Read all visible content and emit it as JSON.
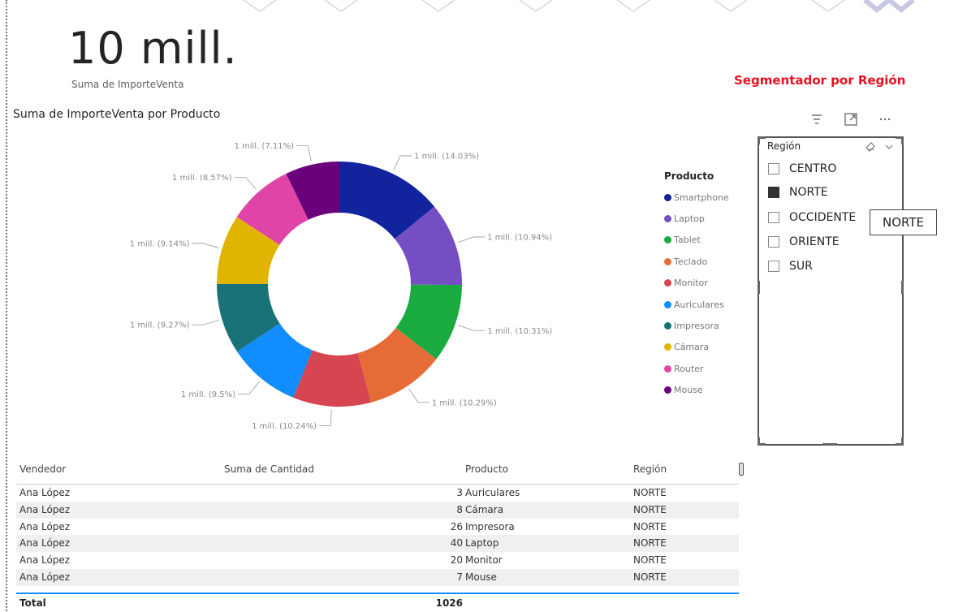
{
  "kpi": {
    "value": "10 mill.",
    "label": "Suma de ImporteVenta"
  },
  "chart_data": {
    "type": "pie",
    "donut": true,
    "title": "Suma de ImporteVenta por Producto",
    "legend_title": "Producto",
    "legend_position": "right",
    "slices": [
      {
        "name": "Smartphone",
        "label": "1 mill. (14.03%)",
        "value": 14.03,
        "color": "#12239e"
      },
      {
        "name": "Laptop",
        "label": "1 mill. (10.94%)",
        "value": 10.94,
        "color": "#744ec2"
      },
      {
        "name": "Tablet",
        "label": "1 mill. (10.31%)",
        "value": 10.31,
        "color": "#1aab40"
      },
      {
        "name": "Teclado",
        "label": "1 mill. (10.29%)",
        "value": 10.29,
        "color": "#e66c37"
      },
      {
        "name": "Monitor",
        "label": "1 mill. (10.24%)",
        "value": 10.24,
        "color": "#d64550"
      },
      {
        "name": "Auriculares",
        "label": "1 mill. (9.5%)",
        "value": 9.5,
        "color": "#118dff"
      },
      {
        "name": "Impresora",
        "label": "1 mill. (9.27%)",
        "value": 9.27,
        "color": "#197278"
      },
      {
        "name": "Cámara",
        "label": "1 mill. (9.14%)",
        "value": 9.14,
        "color": "#e0b400"
      },
      {
        "name": "Router",
        "label": "1 mill. (8.57%)",
        "value": 8.57,
        "color": "#e044a7"
      },
      {
        "name": "Mouse",
        "label": "1 mill. (7.11%)",
        "value": 7.11,
        "color": "#6b007b"
      }
    ]
  },
  "slicer": {
    "heading": "Segmentador por Región",
    "title": "Región",
    "toolbar_icons": [
      "filter-icon",
      "focus-mode-icon",
      "more-options-icon"
    ],
    "items": [
      {
        "label": "CENTRO",
        "checked": false
      },
      {
        "label": "NORTE",
        "checked": true
      },
      {
        "label": "OCCIDENTE",
        "checked": false
      },
      {
        "label": "ORIENTE",
        "checked": false
      },
      {
        "label": "SUR",
        "checked": false
      }
    ],
    "tooltip": "NORTE"
  },
  "table": {
    "headers": [
      "Vendedor",
      "Suma de Cantidad",
      "Producto",
      "Región"
    ],
    "rows": [
      [
        "Ana López",
        "3",
        "Auriculares",
        "NORTE"
      ],
      [
        "Ana López",
        "8",
        "Cámara",
        "NORTE"
      ],
      [
        "Ana López",
        "26",
        "Impresora",
        "NORTE"
      ],
      [
        "Ana López",
        "40",
        "Laptop",
        "NORTE"
      ],
      [
        "Ana López",
        "20",
        "Monitor",
        "NORTE"
      ],
      [
        "Ana López",
        "7",
        "Mouse",
        "NORTE"
      ]
    ],
    "total_label": "Total",
    "total_value": "1026"
  }
}
